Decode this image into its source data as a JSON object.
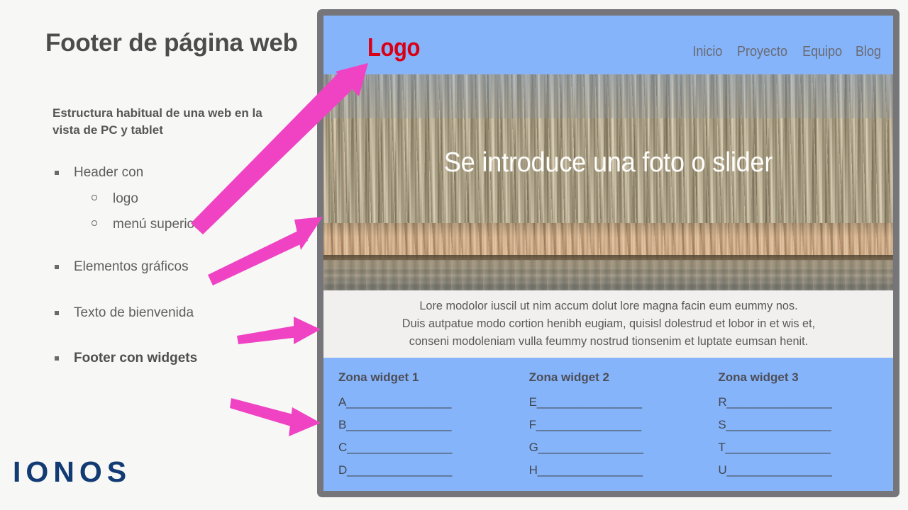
{
  "slide": {
    "title": "Footer de página web",
    "subtitle": "Estructura habitual de una web en la vista de PC y tablet",
    "brand_logo": "IONOS",
    "brand_color": "#123a73",
    "arrow_color": "#ef43c4"
  },
  "bullets": [
    {
      "label": "Header con",
      "bold": false,
      "children": [
        {
          "label": "logo"
        },
        {
          "label": "menú superior"
        }
      ]
    },
    {
      "label": "Elementos gráficos",
      "bold": false,
      "children": []
    },
    {
      "label": "Texto de bienvenida",
      "bold": false,
      "children": []
    },
    {
      "label": "Footer con widgets",
      "bold": true,
      "children": []
    }
  ],
  "mockup": {
    "frame_color": "#76767a",
    "header": {
      "background": "#85b4fb",
      "logo_text": "Logo",
      "logo_color": "#d90015",
      "nav": [
        "Inicio",
        "Proyecto",
        "Equipo",
        "Blog"
      ]
    },
    "hero": {
      "caption": "Se introduce una foto o slider",
      "image_alt": "foto de bosque de álamos sin hojas junto a un lago con cañaveral"
    },
    "welcome": {
      "background": "#f1f0ee",
      "text": "Lore modolor iuscil ut nim accum dolut lore magna facin eum eummy nos.\nDuis autpatue modo cortion henibh eugiam, quisisl dolestrud et lobor in et wis et,\nconseni modoleniam vulla feummy nostrud tionsenim et luptate eumsan henit."
    },
    "footer": {
      "background": "#85b4fb",
      "columns": [
        {
          "title": "Zona widget 1",
          "lines": [
            "A________________",
            "B________________",
            "C________________",
            "D________________"
          ]
        },
        {
          "title": "Zona widget 2",
          "lines": [
            "E________________",
            "F________________",
            "G________________",
            "H________________"
          ]
        },
        {
          "title": "Zona widget 3",
          "lines": [
            "R________________",
            "S________________",
            "T________________",
            "U________________"
          ]
        }
      ]
    }
  }
}
